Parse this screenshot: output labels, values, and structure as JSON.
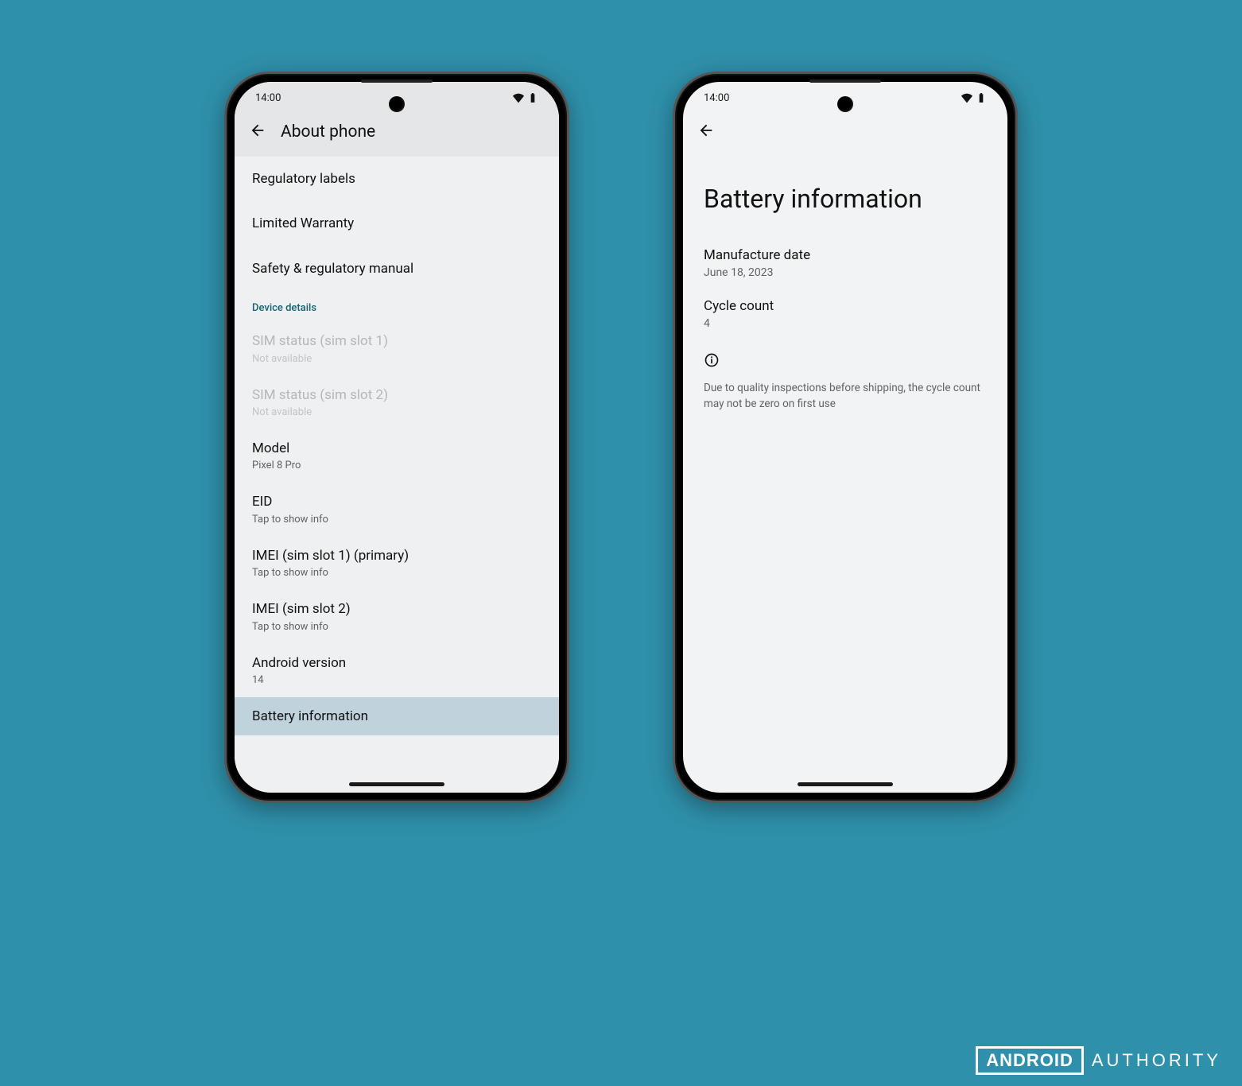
{
  "status": {
    "time": "14:00"
  },
  "phone1": {
    "header_title": "About phone",
    "items_top": [
      {
        "label": "Regulatory labels"
      },
      {
        "label": "Limited Warranty"
      },
      {
        "label": "Safety & regulatory manual"
      }
    ],
    "section_label": "Device details",
    "items_details": [
      {
        "label": "SIM status (sim slot 1)",
        "sub": "Not available",
        "disabled": true
      },
      {
        "label": "SIM status (sim slot 2)",
        "sub": "Not available",
        "disabled": true
      },
      {
        "label": "Model",
        "sub": "Pixel 8 Pro"
      },
      {
        "label": "EID",
        "sub": "Tap to show info"
      },
      {
        "label": "IMEI (sim slot 1) (primary)",
        "sub": "Tap to show info"
      },
      {
        "label": "IMEI (sim slot 2)",
        "sub": "Tap to show info"
      },
      {
        "label": "Android version",
        "sub": "14"
      },
      {
        "label": "Battery information",
        "highlight": true
      }
    ]
  },
  "phone2": {
    "page_title": "Battery information",
    "blocks": [
      {
        "label": "Manufacture date",
        "value": "June 18, 2023"
      },
      {
        "label": "Cycle count",
        "value": "4"
      }
    ],
    "note": "Due to quality inspections before shipping, the cycle count may not be zero on first use"
  },
  "watermark": {
    "boxed": "ANDROID",
    "plain": "AUTHORITY"
  }
}
